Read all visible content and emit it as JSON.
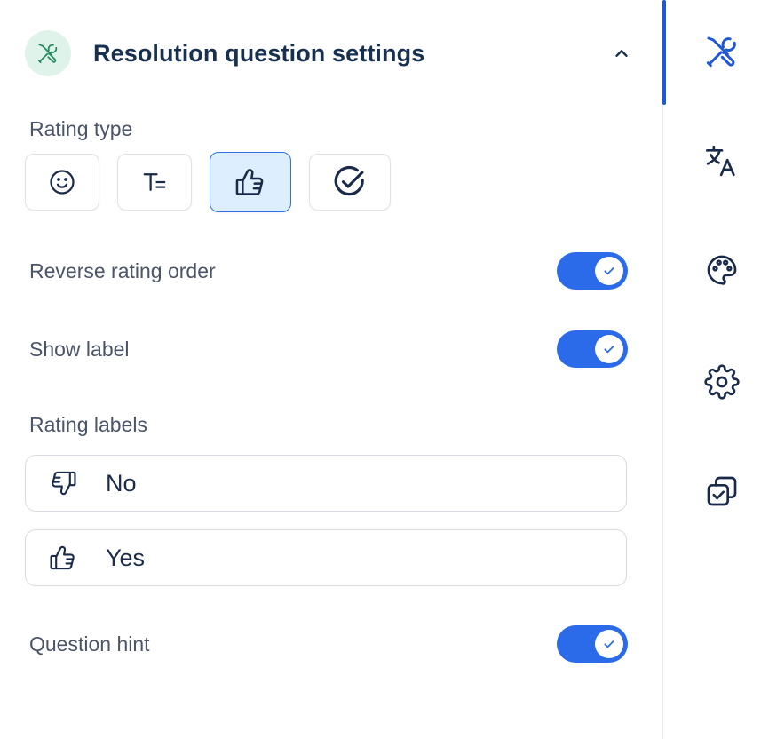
{
  "header": {
    "title": "Resolution question settings",
    "icon": "tools-icon",
    "collapse_icon": "chevron-up-icon"
  },
  "rating_type": {
    "label": "Rating type",
    "options": [
      {
        "icon": "smiley-icon",
        "selected": false
      },
      {
        "icon": "text-scale-icon",
        "selected": false
      },
      {
        "icon": "thumbs-up-icon",
        "selected": true
      },
      {
        "icon": "check-circle-icon",
        "selected": false
      }
    ]
  },
  "reverse_rating_order": {
    "label": "Reverse rating order",
    "enabled": true
  },
  "show_label": {
    "label": "Show label",
    "enabled": true
  },
  "rating_labels": {
    "label": "Rating labels",
    "items": [
      {
        "icon": "thumbs-down-icon",
        "value": "No"
      },
      {
        "icon": "thumbs-up-icon",
        "value": "Yes"
      }
    ]
  },
  "question_hint": {
    "label": "Question hint",
    "enabled": true
  },
  "rail": {
    "items": [
      "tools-icon",
      "translate-icon",
      "palette-icon",
      "gear-icon",
      "duplicate-check-icon"
    ],
    "active": "tools-icon"
  },
  "colors": {
    "accent": "#2b6ae8",
    "selected_bg": "#ddeeff",
    "header_icon_bg": "#dff3ea",
    "header_icon_fg": "#1f8a5c",
    "title": "#18304f",
    "label": "#4a5568"
  }
}
